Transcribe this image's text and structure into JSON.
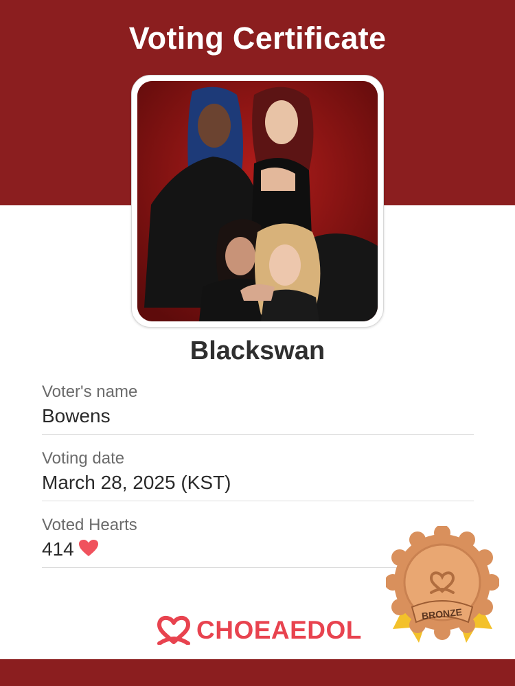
{
  "header": {
    "title": "Voting Certificate"
  },
  "artist": {
    "name": "Blackswan"
  },
  "fields": [
    {
      "label": "Voter's name",
      "value": "Bowens"
    },
    {
      "label": "Voting date",
      "value": "March 28, 2025 (KST)"
    },
    {
      "label": "Voted Hearts",
      "value": "414"
    }
  ],
  "icons": {
    "hearts": "heart-icon",
    "brand": "choeaedol-logo-icon"
  },
  "brand": {
    "name": "CHOEAEDOL"
  },
  "badge": {
    "label": "BRONZE"
  },
  "colors": {
    "primary": "#8b1e1f",
    "accent": "#e8434f",
    "badge": "#d9905c",
    "ribbon": "#f3c12a"
  }
}
